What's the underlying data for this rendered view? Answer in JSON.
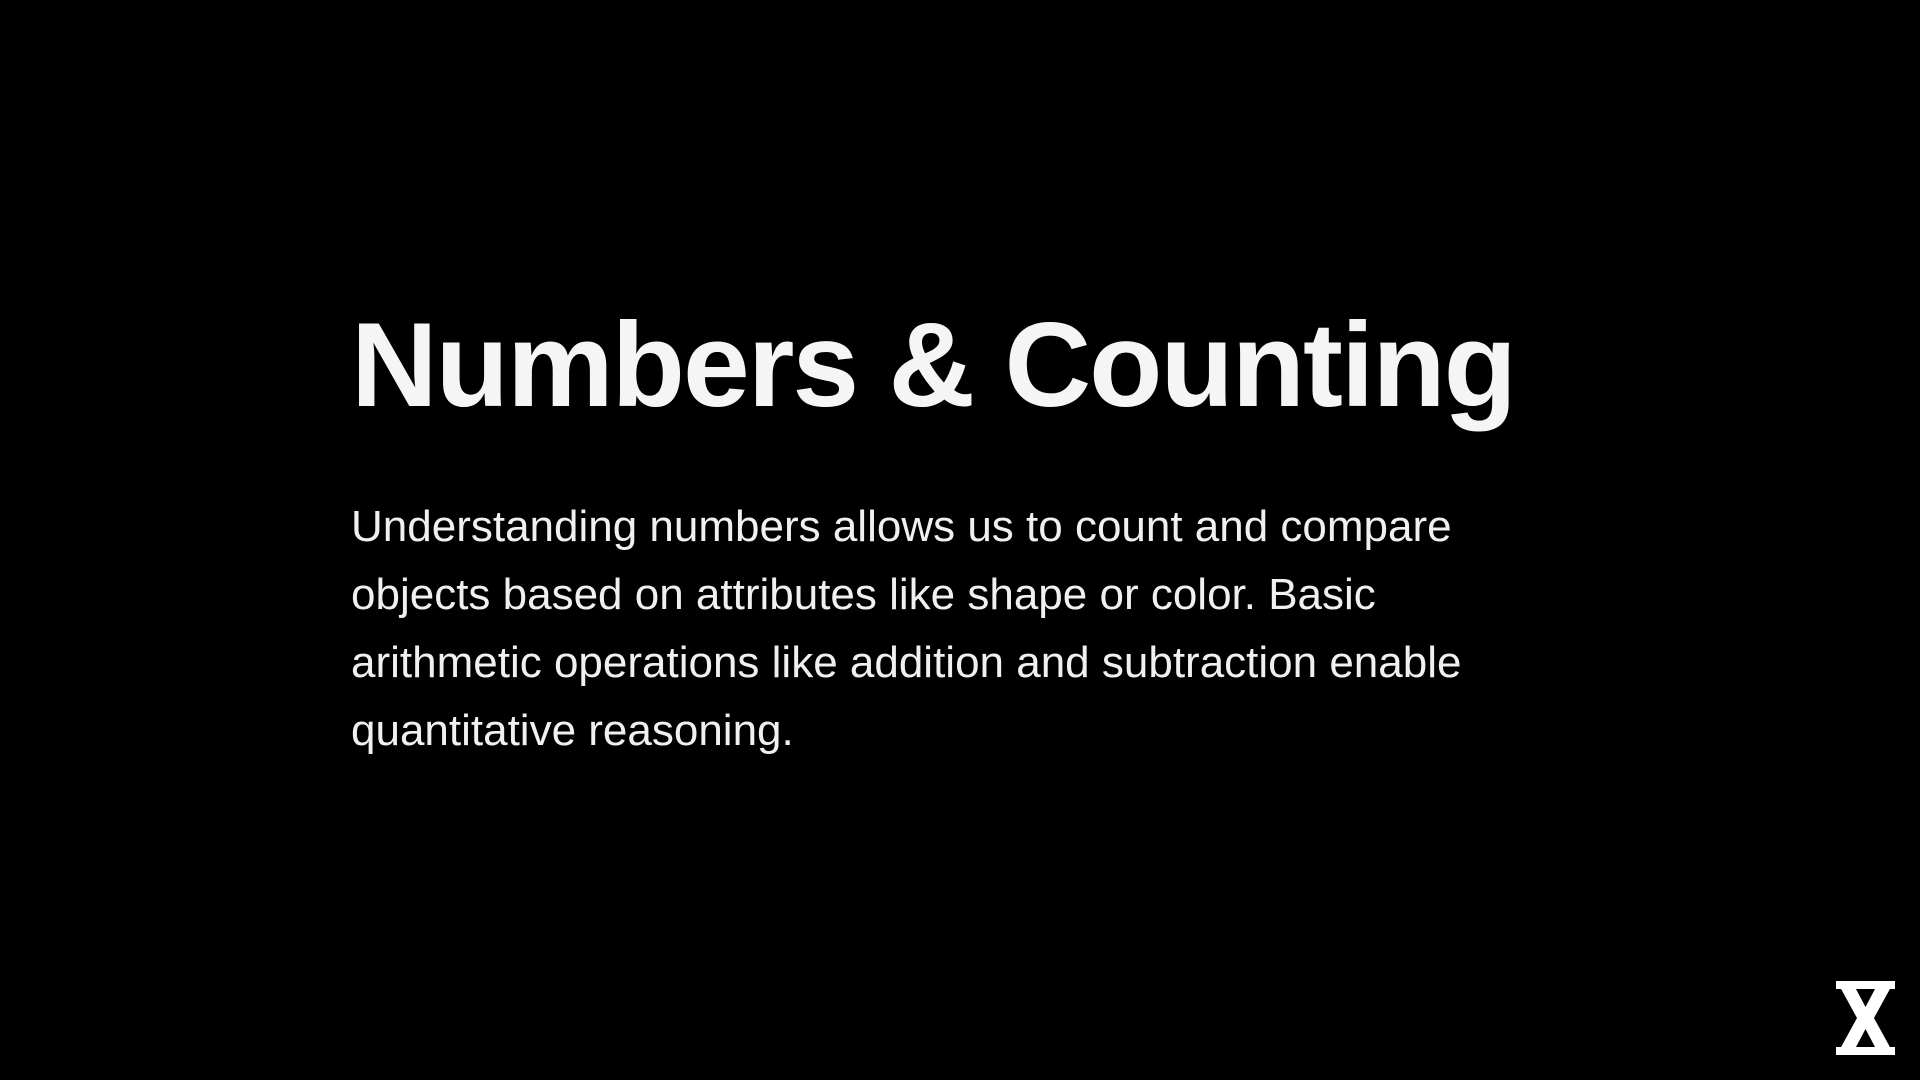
{
  "slide": {
    "title": "Numbers & Counting",
    "body": "Understanding numbers allows us to count and compare objects based on attributes like shape or color. Basic arithmetic operations like addition and subtraction enable quantitative reasoning."
  },
  "logo": {
    "icon": "hourglass-x-logo-icon"
  },
  "colors": {
    "background": "#000000",
    "text": "#f5f5f5"
  }
}
